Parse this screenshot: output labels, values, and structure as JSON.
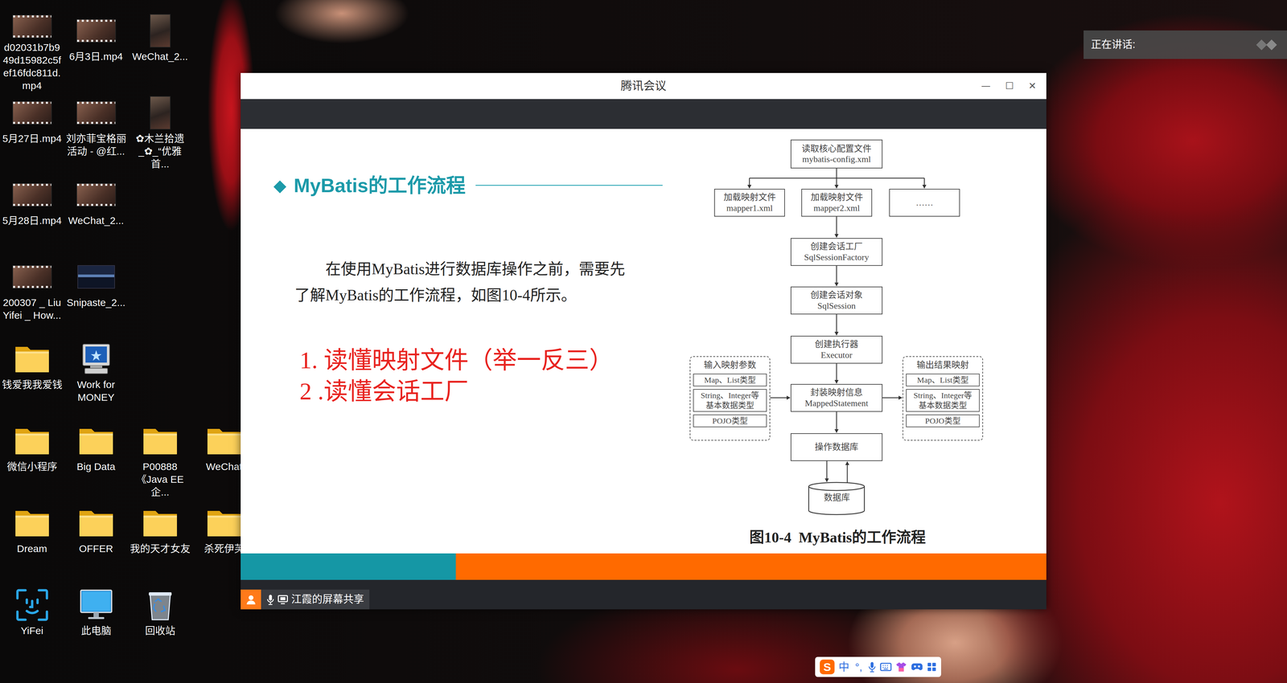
{
  "desktop": {
    "rows": [
      [
        {
          "label": "d02031b7b949d15982c5fef16fdc811d.mp4",
          "kind": "video"
        },
        {
          "label": "6月3日.mp4",
          "kind": "video"
        },
        {
          "label": "WeChat_2...",
          "kind": "video-portrait"
        }
      ],
      [
        {
          "label": "5月27日.mp4",
          "kind": "video"
        },
        {
          "label": "刘亦菲宝格丽活动 - @红...",
          "kind": "video"
        },
        {
          "label": "✿木兰拾遗_✿_“优雅首...",
          "kind": "video-portrait"
        }
      ],
      [
        {
          "label": "5月28日.mp4",
          "kind": "video"
        },
        {
          "label": "WeChat_2...",
          "kind": "video"
        }
      ],
      [
        {
          "label": "200307 _ Liu Yifei _ How...",
          "kind": "video"
        },
        {
          "label": "Snipaste_2...",
          "kind": "image"
        }
      ],
      [
        {
          "label": "钱爱我我爱钱",
          "kind": "folder"
        },
        {
          "label": "Work for MONEY",
          "kind": "computer"
        }
      ],
      [
        {
          "label": "微信小程序",
          "kind": "folder"
        },
        {
          "label": "Big Data",
          "kind": "folder"
        },
        {
          "label": "P00888《Java EE企...",
          "kind": "folder"
        },
        {
          "label": "WeChat",
          "kind": "folder"
        }
      ],
      [
        {
          "label": "Dream",
          "kind": "folder"
        },
        {
          "label": "OFFER",
          "kind": "folder"
        },
        {
          "label": "我的天才女友",
          "kind": "folder"
        },
        {
          "label": "杀死伊芙",
          "kind": "folder"
        }
      ],
      [
        {
          "label": "YiFei",
          "kind": "faceid"
        },
        {
          "label": "此电脑",
          "kind": "pc"
        },
        {
          "label": "回收站",
          "kind": "recycle"
        }
      ]
    ]
  },
  "speaking": {
    "label": "正在讲话:"
  },
  "meeting": {
    "title": "腾讯会议",
    "controls": [
      "—",
      "☐",
      "✕"
    ],
    "share_label": "江霞的屏幕共享",
    "slide": {
      "title_marker": "◆",
      "title": "MyBatis的工作流程",
      "paragraph_lines": [
        "在使用MyBatis进行数据库操作之前，需要先",
        "了解MyBatis的工作流程，如图10-4所示。"
      ],
      "points": [
        "1. 读懂映射文件（举一反三）",
        "2 .读懂会话工厂"
      ],
      "diagram": {
        "config": {
          "lines": [
            "读取核心配置文件",
            "mybatis-config.xml"
          ]
        },
        "mappers": [
          {
            "lines": [
              "加载映射文件",
              "mapper1.xml"
            ]
          },
          {
            "lines": [
              "加载映射文件",
              "mapper2.xml"
            ]
          },
          {
            "lines": [
              "……"
            ]
          }
        ],
        "steps": [
          {
            "lines": [
              "创建会话工厂",
              "SqlSessionFactory"
            ]
          },
          {
            "lines": [
              "创建会话对象",
              "SqlSession"
            ]
          },
          {
            "lines": [
              "创建执行器",
              "Executor"
            ]
          },
          {
            "lines": [
              "封装映射信息",
              "MappedStatement"
            ]
          },
          {
            "lines": [
              "操作数据库"
            ]
          }
        ],
        "database": "数据库",
        "input": {
          "title": "输入映射参数",
          "items": [
            [
              "Map、List类型"
            ],
            [
              "String、Integer等",
              "基本数据类型"
            ],
            [
              "POJO类型"
            ]
          ]
        },
        "output": {
          "title": "输出结果映射",
          "items": [
            [
              "Map、List类型"
            ],
            [
              "String、Integer等",
              "基本数据类型"
            ],
            [
              "POJO类型"
            ]
          ]
        },
        "caption": "图10-4  MyBatis的工作流程"
      }
    }
  },
  "ime": {
    "items": [
      {
        "kind": "logo",
        "label": "S"
      },
      {
        "kind": "text",
        "label": "中"
      },
      {
        "kind": "text",
        "label": "°,"
      },
      {
        "kind": "mic"
      },
      {
        "kind": "keyboard"
      },
      {
        "kind": "skin"
      },
      {
        "kind": "game"
      },
      {
        "kind": "grid"
      }
    ]
  }
}
